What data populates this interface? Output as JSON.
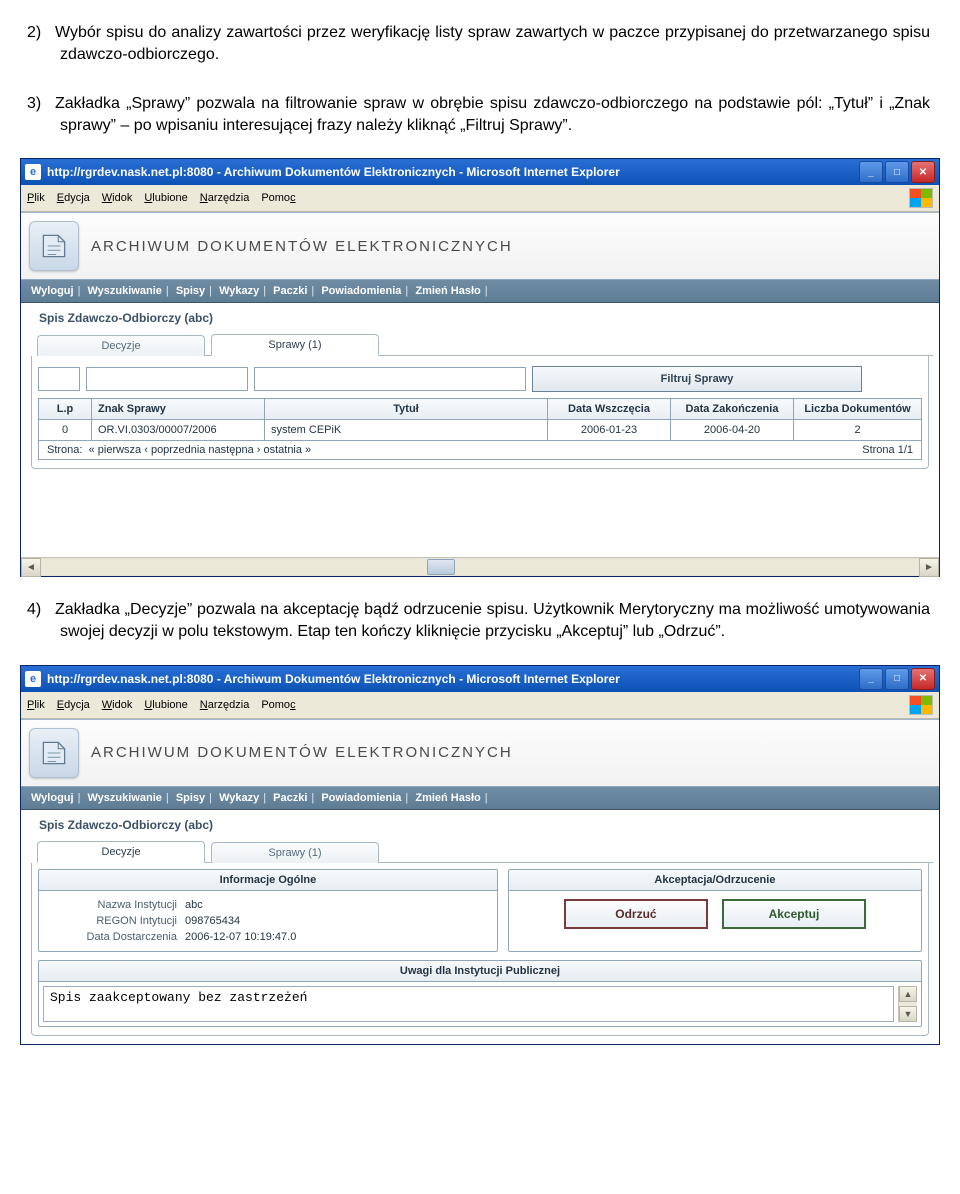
{
  "doc": {
    "p2_num": "2)",
    "p2": "Wybór spisu do analizy zawartości przez weryfikację listy spraw zawartych w paczce przypisanej do przetwarzanego spisu zdawczo-odbiorczego.",
    "p3_num": "3)",
    "p3": "Zakładka „Sprawy” pozwala na filtrowanie spraw w obrębie spisu zdawczo-odbiorczego na podstawie pól: „Tytuł” i „Znak sprawy” – po wpisaniu interesującej frazy należy kliknąć „Filtruj Sprawy”.",
    "p4_num": "4)",
    "p4": "Zakładka „Decyzje” pozwala na akceptację bądź odrzucenie spisu. Użytkownik Merytoryczny ma możliwość umotywowania swojej decyzji w polu tekstowym. Etap ten kończy kliknięcie przycisku „Akceptuj” lub „Odrzuć”."
  },
  "ie": {
    "title": "http://rgrdev.nask.net.pl:8080 - Archiwum Dokumentów Elektronicznych - Microsoft Internet Explorer",
    "menu": {
      "plik": "Plik",
      "edycja": "Edycja",
      "widok": "Widok",
      "ulubione": "Ulubione",
      "narzedzia": "Narzędzia",
      "pomoc": "Pomoc"
    }
  },
  "app": {
    "title": "ARCHIWUM DOKUMENTÓW ELEKTRONICZNYCH",
    "nav": [
      "Wyloguj",
      "Wyszukiwanie",
      "Spisy",
      "Wykazy",
      "Paczki",
      "Powiadomienia",
      "Zmień Hasło"
    ],
    "subtitle": "Spis Zdawczo-Odbiorczy (abc)",
    "tabs": {
      "decyzje": "Decyzje",
      "sprawy": "Sprawy (1)"
    }
  },
  "sprawy": {
    "filter_btn": "Filtruj Sprawy",
    "headers": {
      "lp": "L.p",
      "znak": "Znak Sprawy",
      "tytul": "Tytuł",
      "data_w": "Data Wszczęcia",
      "data_z": "Data Zakończenia",
      "liczba": "Liczba Dokumentów"
    },
    "row": {
      "lp": "0",
      "znak": "OR.VI.0303/00007/2006",
      "tytul": "system CEPiK",
      "data_w": "2006-01-23",
      "data_z": "2006-04-20",
      "liczba": "2"
    },
    "footer_left_label": "Strona:",
    "footer_left_nav": "« pierwsza  ‹ poprzednia  następna ›  ostatnia »",
    "footer_right": "Strona 1/1"
  },
  "decyzje": {
    "info_header": "Informacje Ogólne",
    "accept_header": "Akceptacja/Odrzucenie",
    "info": {
      "nazwa_l": "Nazwa Instytucji",
      "nazwa_v": "abc",
      "regon_l": "REGON Intytucji",
      "regon_v": "098765434",
      "data_l": "Data Dostarczenia",
      "data_v": "2006-12-07 10:19:47.0"
    },
    "btn_reject": "Odrzuć",
    "btn_accept": "Akceptuj",
    "uwagi_header": "Uwagi dla Instytucji Publicznej",
    "uwagi_text": "Spis zaakceptowany bez zastrzeżeń"
  }
}
